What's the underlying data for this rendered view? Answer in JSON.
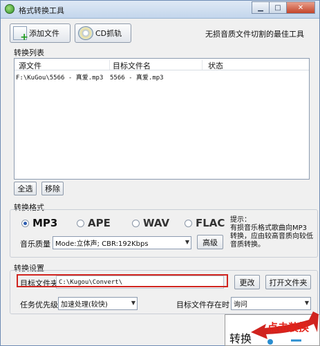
{
  "window": {
    "title": "格式转换工具"
  },
  "toolbar": {
    "add_file": "添加文件",
    "cd_rip": "CD抓轨",
    "slogan": "无损音质文件切割的最佳工具"
  },
  "list": {
    "section_label": "转换列表",
    "columns": [
      "源文件",
      "目标文件名",
      "状态"
    ],
    "rows": [
      {
        "source": "F:\\KuGou\\5566 - 真爱.mp3",
        "target": "5566 - 真爱.mp3",
        "status": ""
      }
    ]
  },
  "list_buttons": {
    "select_all": "全选",
    "remove": "移除"
  },
  "format": {
    "section_label": "转换格式",
    "options": [
      "MP3",
      "APE",
      "WAV",
      "FLAC"
    ],
    "selected": "MP3",
    "quality_label": "音乐质量",
    "quality_value": "Mode:立体声; CBR:192Kbps",
    "advanced": "高级",
    "tip": "提示：\n  有损音乐格式歌曲向MP3\n转换，应由较高音质向较低\n音质转换。"
  },
  "settings": {
    "section_label": "转换设置",
    "target_folder_label": "目标文件夹",
    "target_folder_value": "C:\\Kugou\\Convert\\",
    "change": "更改",
    "open_folder": "打开文件夹",
    "priority_label": "任务优先级",
    "priority_value": "加速处理(较快)",
    "exists_label": "目标文件存在时",
    "exists_value": "询问"
  },
  "convert": {
    "label": "转换",
    "annotation": "点击装换"
  },
  "colors": {
    "accent_red": "#d0241f",
    "annotation_red": "#e32219"
  }
}
